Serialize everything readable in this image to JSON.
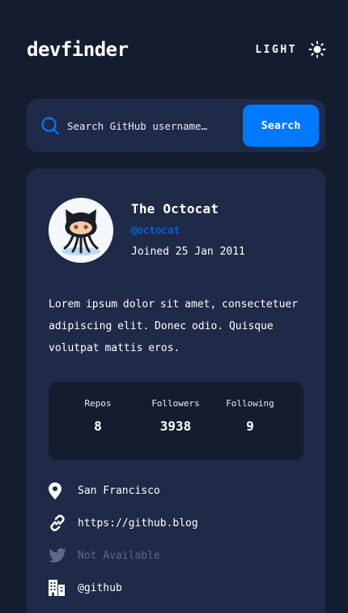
{
  "app": {
    "logo": "devfinder",
    "theme_toggle_label": "LIGHT"
  },
  "search": {
    "placeholder": "Search GitHub username…",
    "value": "",
    "button_label": "Search"
  },
  "profile": {
    "name": "The Octocat",
    "login": "@octocat",
    "joined": "Joined 25 Jan 2011",
    "bio": "Lorem ipsum dolor sit amet, consectetuer adipiscing elit. Donec odio. Quisque volutpat mattis eros.",
    "stats": {
      "repos_label": "Repos",
      "repos_value": "8",
      "followers_label": "Followers",
      "followers_value": "3938",
      "following_label": "Following",
      "following_value": "9"
    },
    "links": {
      "location": "San Francisco",
      "blog": "https://github.blog",
      "twitter": "Not Available",
      "company": "@github"
    }
  },
  "colors": {
    "background": "#141d2f",
    "card": "#1e2a47",
    "accent": "#0079ff",
    "text": "#ffffff",
    "muted": "#5c6b8c"
  },
  "icons": {
    "theme": "sun-icon",
    "search": "search-icon",
    "location": "location-pin-icon",
    "blog": "link-icon",
    "twitter": "twitter-icon",
    "company": "building-icon"
  }
}
